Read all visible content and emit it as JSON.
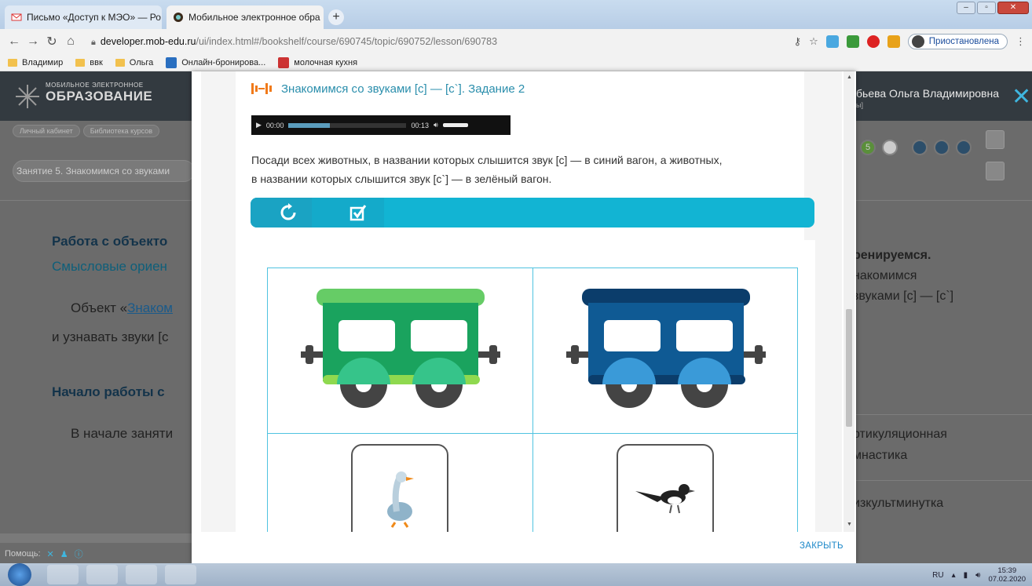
{
  "browser": {
    "tabs": [
      {
        "label": "Письмо «Доступ к МЭО» — Ро",
        "close": "×"
      },
      {
        "label": "Мобильное электронное обра",
        "close": "×"
      }
    ],
    "new_tab": "+",
    "window_buttons": [
      "–",
      "▫",
      "✕"
    ],
    "url_host": "developer.mob-edu.ru",
    "url_path": "/ui/index.html#/bookshelf/course/690745/topic/690752/lesson/690783",
    "profile_status": "Приостановлена",
    "bookmarks": [
      "Владимир",
      "ввк",
      "Ольга",
      "Онлайн-бронирова...",
      "молочная кухня"
    ]
  },
  "app": {
    "logo_line1": "МОБИЛЬНОЕ ЭЛЕКТРОННОЕ",
    "logo_line2": "ОБРАЗОВАНИЕ",
    "user_name": "бьева Ольга Владимировна",
    "user_sub": "ы]",
    "breadcrumbs": [
      "Личный кабинет",
      "Библиотека курсов"
    ],
    "lesson_title": "Занятие 5. Знакомимся со звуками",
    "step_number": "5",
    "left_texts": {
      "heading1": "Работа с объекто",
      "sub1": "Смысловые ориен",
      "para1_prefix": "Объект «",
      "para1_link": "Знаком",
      "para2": "и узнавать звуки [с",
      "heading2": "Начало работы с",
      "para3": "В начале заняти"
    },
    "right_texts": {
      "r1": "ренируемся.",
      "r2": "накомимся",
      "r3": "звуками [с] — [с`]",
      "r4": "ртикуляционная",
      "r5": "мнастика",
      "r6": "изкультминутка"
    },
    "help_label": "Помощь:"
  },
  "modal": {
    "title": "Знакомимся со звуками [с] — [с`]. Задание 2",
    "audio_current": "00:00",
    "audio_total": "00:13",
    "audio_progress": 0.35,
    "instruction_line1": "Посади всех животных, в названии которых слышится звук [с] — в синий вагон, а животных,",
    "instruction_line2": "в названии которых слышится звук [с`] — в зелёный вагон.",
    "close_label": "ЗАКРЫТЬ",
    "colors": {
      "accent": "#12b4d3",
      "green_wagon": "#1aa35e",
      "blue_wagon": "#0f5a94",
      "title": "#2a8eac"
    }
  },
  "taskbar": {
    "lang": "RU",
    "time": "15:39",
    "date": "07.02.2020"
  }
}
